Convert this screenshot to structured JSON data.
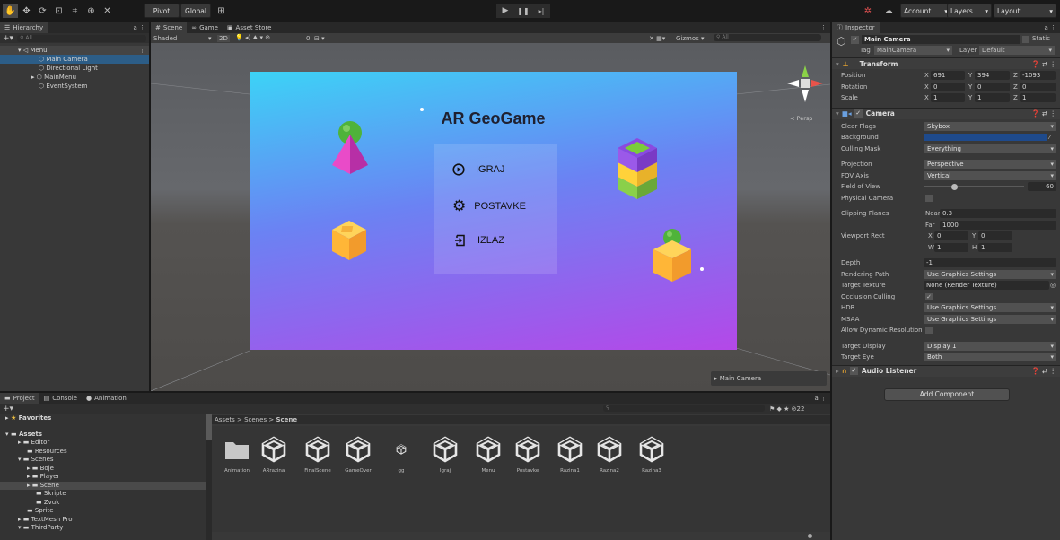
{
  "toolbar": {
    "pivot": "Pivot",
    "global": "Global",
    "account": "Account",
    "layers": "Layers",
    "layout": "Layout"
  },
  "hierarchy": {
    "tab": "Hierarchy",
    "search": "All",
    "items": [
      "Menu",
      "Main Camera",
      "Directional Light",
      "MainMenu",
      "EventSystem"
    ]
  },
  "scene": {
    "tabs": [
      "Scene",
      "Game",
      "Asset Store"
    ],
    "shading": "Shaded",
    "mode2d": "2D",
    "gizmos": "Gizmos",
    "search": "All",
    "persp": "< Persp",
    "cam_overlay": "Main Camera",
    "layer_count": "0"
  },
  "game_ui": {
    "title": "AR GeoGame",
    "btn_play": "IGRAJ",
    "btn_settings": "POSTAVKE",
    "btn_exit": "IZLAZ"
  },
  "inspector": {
    "tab": "Inspector",
    "object_name": "Main Camera",
    "static": "Static",
    "tag_label": "Tag",
    "tag": "MainCamera",
    "layer_label": "Layer",
    "layer": "Default",
    "transform": {
      "title": "Transform",
      "position_label": "Position",
      "rotation_label": "Rotation",
      "scale_label": "Scale",
      "position": [
        "691",
        "394",
        "-1093"
      ],
      "rotation": [
        "0",
        "0",
        "0"
      ],
      "scale": [
        "1",
        "1",
        "1"
      ]
    },
    "camera": {
      "title": "Camera",
      "clear_flags_label": "Clear Flags",
      "clear_flags": "Skybox",
      "background_label": "Background",
      "culling_label": "Culling Mask",
      "culling": "Everything",
      "projection_label": "Projection",
      "projection": "Perspective",
      "fov_axis_label": "FOV Axis",
      "fov_axis": "Vertical",
      "fov_label": "Field of View",
      "fov": "60",
      "fov_fraction": 0.3,
      "physical_label": "Physical Camera",
      "clipping_label": "Clipping Planes",
      "near_label": "Near",
      "near": "0.3",
      "far_label": "Far",
      "far": "1000",
      "viewport_label": "Viewport Rect",
      "vx": "0",
      "vy": "0",
      "vw": "1",
      "vh": "1",
      "depth_label": "Depth",
      "depth": "-1",
      "rendering_path_label": "Rendering Path",
      "rendering_path": "Use Graphics Settings",
      "target_texture_label": "Target Texture",
      "target_texture": "None (Render Texture)",
      "occlusion_label": "Occlusion Culling",
      "hdr_label": "HDR",
      "hdr": "Use Graphics Settings",
      "msaa_label": "MSAA",
      "msaa": "Use Graphics Settings",
      "dyn_res_label": "Allow Dynamic Resolution",
      "target_display_label": "Target Display",
      "target_display": "Display 1",
      "target_eye_label": "Target Eye",
      "target_eye": "Both",
      "bg_color": "#1e4a8c"
    },
    "audio": {
      "title": "Audio Listener"
    },
    "add_component": "Add Component"
  },
  "project": {
    "tabs": [
      "Project",
      "Console",
      "Animation"
    ],
    "favorites": "Favorites",
    "breadcrumb": [
      "Assets",
      "Scenes",
      "Scene"
    ],
    "count": "22",
    "tree": [
      "Assets",
      "Editor",
      "Resources",
      "Scenes",
      "Boje",
      "Player",
      "Scene",
      "Skripte",
      "Zvuk",
      "Sprite",
      "TextMesh Pro",
      "ThirdParty"
    ],
    "assets": [
      "Animation",
      "ARrazina",
      "FinalScene",
      "GameOver",
      "gg",
      "Igraj",
      "Menu",
      "Postavke",
      "Razina1",
      "Razina2",
      "Razina3"
    ]
  },
  "xyz": {
    "x": "X",
    "y": "Y",
    "z": "Z",
    "w": "W",
    "h": "H"
  }
}
